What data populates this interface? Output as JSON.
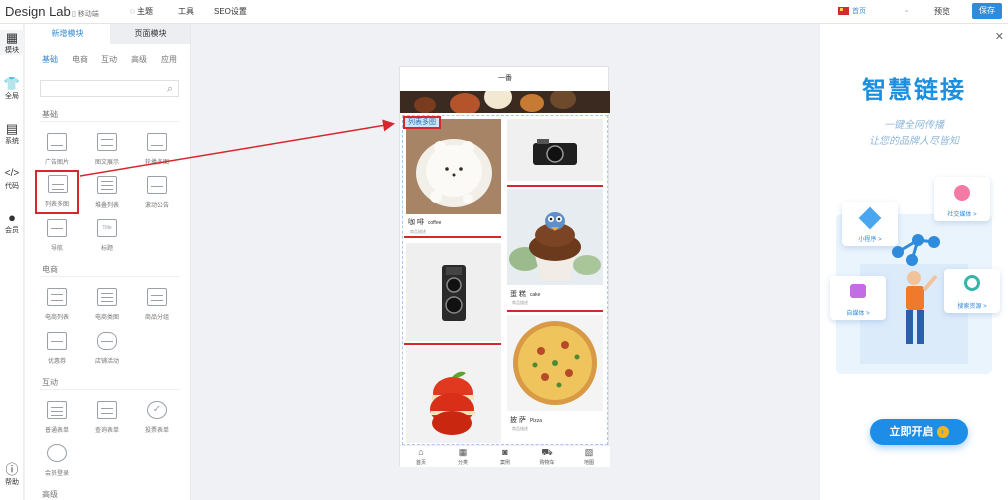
{
  "topbar": {
    "brand": "Design Lab",
    "mobile": "移动端",
    "menu": [
      "主题",
      "工具",
      "SEO设置"
    ],
    "home_select": "首页",
    "preview": "预览",
    "save": "保存"
  },
  "rail": [
    "模块",
    "全局",
    "系统",
    "代码",
    "会员",
    "帮助"
  ],
  "panel": {
    "tabs": [
      "新增模块",
      "页面模块"
    ],
    "categories": [
      "基础",
      "电商",
      "互动",
      "高级",
      "应用"
    ],
    "groups": {
      "basic": "基础",
      "ecommerce": "电商",
      "interactive": "互动",
      "advanced": "高级"
    },
    "basic_tiles": [
      "广告图片",
      "图文展示",
      "轮播多图",
      "列表多图",
      "堆叠列表",
      "滚动公告",
      "导航",
      "标题"
    ],
    "ecommerce_tiles": [
      "电商列表",
      "电商类图",
      "商品分组",
      "优惠券",
      "店铺活动"
    ],
    "interactive_tiles": [
      "普通表单",
      "查询表单",
      "投票表单",
      "会员登录"
    ]
  },
  "phone": {
    "title": "一番",
    "tag": "列表多图",
    "items": [
      {
        "name": "咖 啡",
        "en": "coffee"
      },
      {
        "name": "蛋 糕",
        "en": "cake"
      },
      {
        "name": "披 萨",
        "en": "Pizza"
      }
    ],
    "item_sub": "商品描述",
    "nav": [
      "首页",
      "分类",
      "案例",
      "购物车",
      "地图"
    ]
  },
  "promo": {
    "title": "智慧链接",
    "line1": "一键全网传播",
    "line2": "让您的品牌人尽皆知",
    "cards": [
      "小程序 >",
      "社交媒体 >",
      "自媒体 >",
      "搜索资源 >"
    ],
    "cta": "立即开启"
  }
}
